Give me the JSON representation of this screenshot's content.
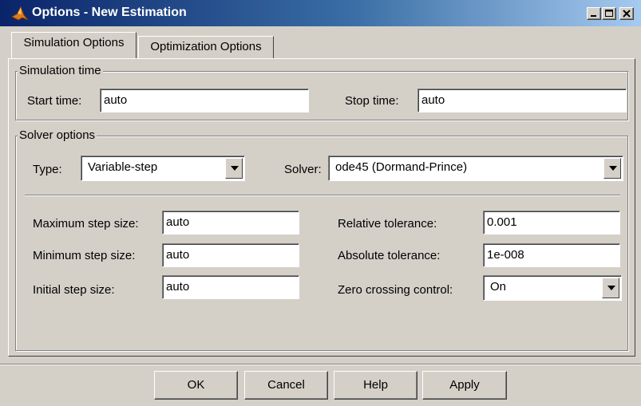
{
  "window": {
    "title": "Options - New Estimation"
  },
  "tabs": [
    {
      "label": "Simulation Options",
      "active": true
    },
    {
      "label": "Optimization Options",
      "active": false
    }
  ],
  "simulation_time": {
    "legend": "Simulation time",
    "start_label": "Start time:",
    "start_value": "auto",
    "stop_label": "Stop time:",
    "stop_value": "auto"
  },
  "solver_options": {
    "legend": "Solver options",
    "type_label": "Type:",
    "type_value": "Variable-step",
    "solver_label": "Solver:",
    "solver_value": "ode45 (Dormand-Prince)",
    "max_step_label": "Maximum step size:",
    "max_step_value": "auto",
    "min_step_label": "Minimum step size:",
    "min_step_value": "auto",
    "init_step_label": "Initial step size:",
    "init_step_value": "auto",
    "rel_tol_label": "Relative tolerance:",
    "rel_tol_value": "0.001",
    "abs_tol_label": "Absolute tolerance:",
    "abs_tol_value": "1e-008",
    "zero_cross_label": "Zero crossing control:",
    "zero_cross_value": "On"
  },
  "buttons": {
    "ok": "OK",
    "cancel": "Cancel",
    "help": "Help",
    "apply": "Apply"
  },
  "colors": {
    "face": "#d4d0c8",
    "title_start": "#0a246a",
    "title_end": "#a6caf0"
  },
  "icons": [
    "matlab-icon",
    "minimize-icon",
    "maximize-icon",
    "close-icon",
    "chevron-down-icon"
  ]
}
